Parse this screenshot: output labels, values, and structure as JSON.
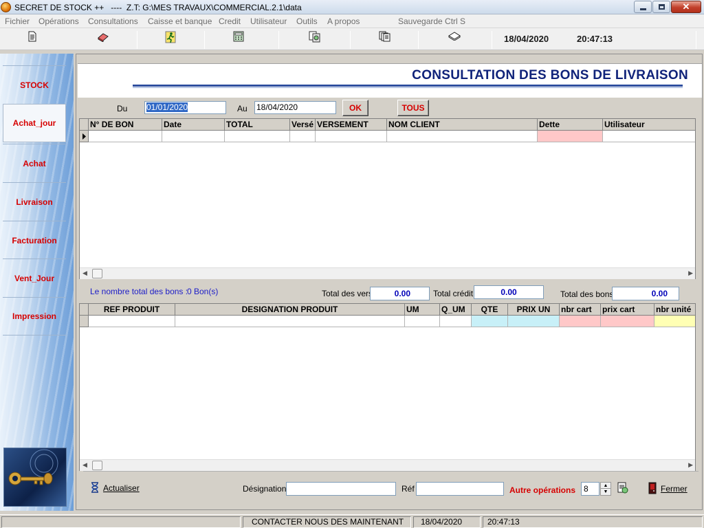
{
  "window": {
    "title": "SECRET DE STOCK ++   ----  Z.T: G:\\MES TRAVAUX\\COMMERCIAL.2.1\\data"
  },
  "menu": [
    "Fichier",
    "Opérations",
    "Consultations",
    "Caisse et banque",
    "Credit",
    "Utilisateur",
    "Outils",
    "A propos",
    "Sauvegarde Ctrl S"
  ],
  "toolbar": {
    "date": "18/04/2020",
    "time": "20:47:13",
    "icons": [
      "document-icon",
      "eraser-icon",
      "running-man-icon",
      "calculator-icon",
      "copy-icon",
      "pages-icon",
      "book-icon"
    ]
  },
  "sidebar": {
    "items": [
      "STOCK",
      "Achat_jour",
      "Achat",
      "Livraison",
      "Facturation",
      "Vent_Jour",
      "Impression"
    ],
    "active": "Achat_jour"
  },
  "header": {
    "title": "CONSULTATION DES BONS DE LIVRAISON"
  },
  "filter": {
    "du_label": "Du",
    "du_value": "01/01/2020",
    "au_label": "Au",
    "au_value": "18/04/2020",
    "ok_label": "OK",
    "tous_label": "TOUS"
  },
  "bons_grid": {
    "columns": [
      "N° DE BON",
      "Date",
      "TOTAL",
      "Versé",
      "VERSEMENT",
      "NOM CLIENT",
      "Dette",
      "Utilisateur"
    ],
    "highlight_column": "Dette",
    "highlight_color": "#ffc8c8"
  },
  "totals": {
    "count_label": "Le nombre total des bons :",
    "count_value": "0 Bon(s)",
    "vers_label": "Total des vers",
    "vers_value": "0.00",
    "credit_label": "Total crédit",
    "credit_value": "0.00",
    "bons_label": "Total des bons",
    "bons_value": "0.00"
  },
  "produits_grid": {
    "columns": [
      "REF PRODUIT",
      "DESIGNATION PRODUIT",
      "UM",
      "Q_UM",
      "QTE",
      "PRIX UN",
      "nbr cart",
      "prix cart",
      "nbr unité"
    ],
    "cell_colors": {
      "QTE": "#c8f0f8",
      "PRIX UN": "#c8f0f8",
      "nbr cart": "#ffc8c8",
      "prix cart": "#ffc8c8",
      "nbr unité": "#ffffb4"
    }
  },
  "bottom": {
    "actualiser_label": "Actualiser",
    "designation_label": "Désignation",
    "ref_label": "Réf",
    "autre_label": "Autre opérations",
    "autre_value": "8",
    "fermer_label": "Fermer"
  },
  "status": {
    "contact": "CONTACTER NOUS DES MAINTENANT",
    "date": "18/04/2020",
    "time": "20:47:13"
  }
}
